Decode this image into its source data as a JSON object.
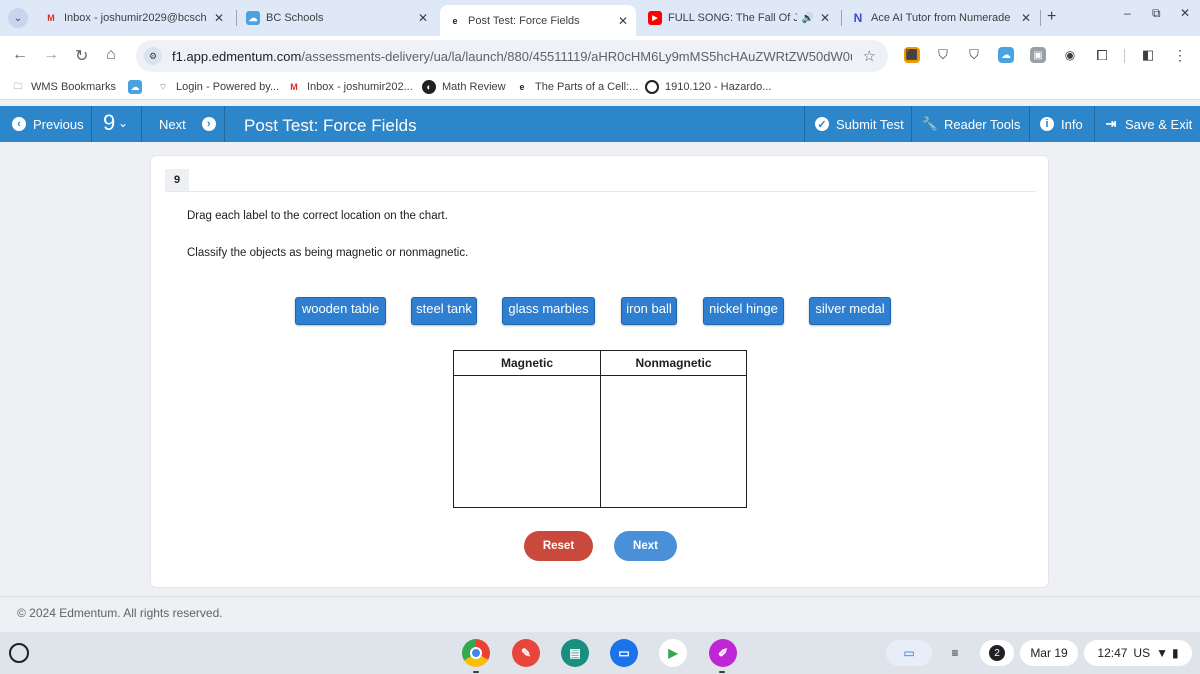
{
  "browser": {
    "tabs": [
      {
        "title": "Inbox - joshumir2029@bcsch",
        "favicon": "gmail-icon"
      },
      {
        "title": "BC Schools",
        "favicon": "cloud-icon"
      },
      {
        "title": "Post Test: Force Fields",
        "favicon": "edmentum-icon"
      },
      {
        "title": "FULL SONG: The Fall Of J",
        "favicon": "youtube-icon"
      },
      {
        "title": "Ace AI Tutor from Numerade",
        "favicon": "numerade-icon"
      }
    ],
    "url_host": "f1.app.edmentum.com",
    "url_path": "/assessments-delivery/ua/la/launch/880/45511119/aHR0cHM6Ly9mMS5hcHAuZWRtZW50dW0uY...",
    "bookmarks": [
      "WMS Bookmarks",
      "Login - Powered by...",
      "Inbox - joshumir202...",
      "Math Review",
      "The Parts of a Cell:...",
      "1910.120 - Hazardo..."
    ]
  },
  "header": {
    "previous": "Previous",
    "question_number": "9",
    "next": "Next",
    "title": "Post Test: Force Fields",
    "submit": "Submit Test",
    "reader_tools": "Reader Tools",
    "info": "Info",
    "save_exit": "Save & Exit"
  },
  "question": {
    "number": "9",
    "instruction1": "Drag each label to the correct location on the chart.",
    "instruction2": "Classify the objects as being magnetic or nonmagnetic.",
    "labels": [
      "wooden table",
      "steel tank",
      "glass marbles",
      "iron ball",
      "nickel hinge",
      "silver medal"
    ],
    "columns": [
      "Magnetic",
      "Nonmagnetic"
    ],
    "reset": "Reset",
    "next": "Next"
  },
  "footer": "© 2024 Edmentum. All rights reserved.",
  "shelf": {
    "notification_count": "2",
    "date": "Mar 19",
    "time": "12:47",
    "locale": "US"
  },
  "colors": {
    "header_blue": "#2d86c9",
    "label_blue": "#2f7fd0",
    "reset_red": "#c94a3c",
    "next_blue": "#4a90d9"
  }
}
